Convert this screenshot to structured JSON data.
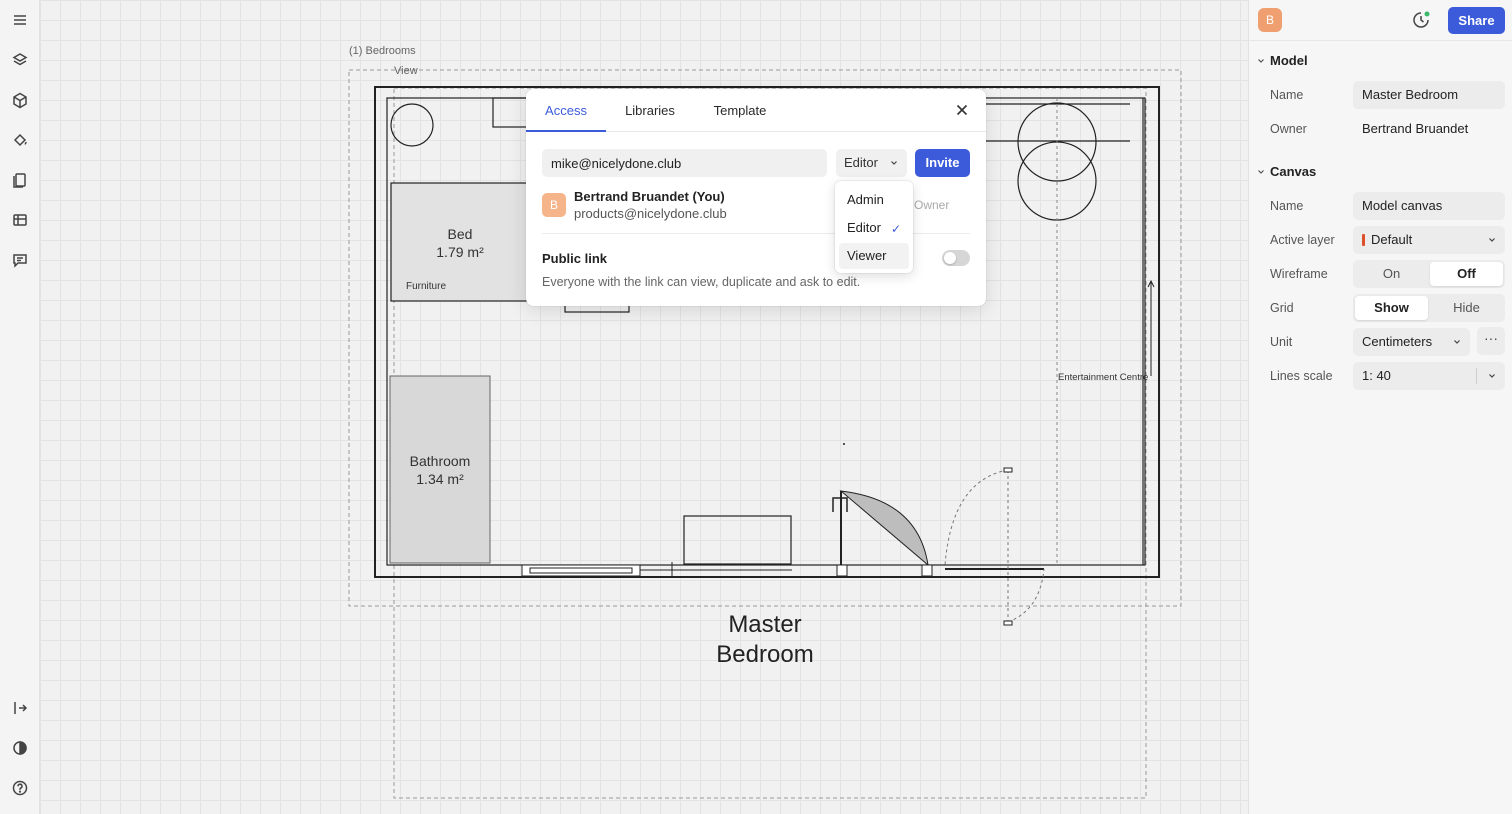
{
  "canvas": {
    "sheet_label": "(1) Bedrooms",
    "view_label": "View",
    "room_title_line1": "Master",
    "room_title_line2": "Bedroom",
    "bed_label": "Bed",
    "bed_area": "1.79 m²",
    "furniture_label": "Furniture",
    "bathroom_label": "Bathroom",
    "bathroom_area": "1.34 m²",
    "entertainment_label": "Entertainment Centre"
  },
  "dialog": {
    "tabs": [
      {
        "label": "Access",
        "active": true
      },
      {
        "label": "Libraries",
        "active": false
      },
      {
        "label": "Template",
        "active": false
      }
    ],
    "email_value": "mike@nicelydone.club",
    "role_selected": "Editor",
    "invite_label": "Invite",
    "member": {
      "initial": "B",
      "name": "Bertrand Bruandet (You)",
      "email": "products@nicelydone.club",
      "role": "Owner"
    },
    "public_link_title": "Public link",
    "public_link_desc": "Everyone with the link can view, duplicate and ask to edit.",
    "public_link_enabled": false,
    "role_menu": [
      {
        "label": "Admin",
        "checked": false
      },
      {
        "label": "Editor",
        "checked": true
      },
      {
        "label": "Viewer",
        "checked": false
      }
    ]
  },
  "right_panel": {
    "avatar_initial": "B",
    "share_label": "Share",
    "model": {
      "title": "Model",
      "name_label": "Name",
      "name_value": "Master Bedroom",
      "owner_label": "Owner",
      "owner_value": "Bertrand Bruandet"
    },
    "canvas": {
      "title": "Canvas",
      "name_label": "Name",
      "name_value": "Model canvas",
      "active_layer_label": "Active layer",
      "active_layer_value": "Default",
      "wireframe_label": "Wireframe",
      "wireframe_on": "On",
      "wireframe_off": "Off",
      "wireframe_selected": "Off",
      "grid_label": "Grid",
      "grid_show": "Show",
      "grid_hide": "Hide",
      "grid_selected": "Show",
      "unit_label": "Unit",
      "unit_value": "Centimeters",
      "lines_scale_label": "Lines scale",
      "lines_scale_value": "1: 40"
    }
  },
  "colors": {
    "accent": "#3b5bdb",
    "avatar": "#f0a070",
    "layer_marker": "#e0502a"
  },
  "icons": [
    "menu-icon",
    "layers-icon",
    "cube-icon",
    "paint-bucket-icon",
    "pages-icon",
    "table-icon",
    "comment-icon",
    "collapse-icon",
    "contrast-icon",
    "help-icon",
    "history-icon",
    "close-icon",
    "chevron-down-icon",
    "check-icon",
    "more-icon"
  ]
}
